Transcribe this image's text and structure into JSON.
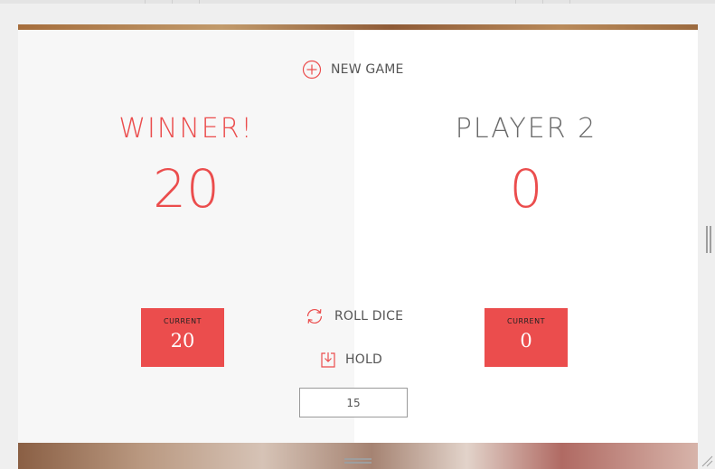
{
  "game": {
    "new_game_label": "NEW GAME",
    "roll_dice_label": "ROLL DICE",
    "hold_label": "HOLD",
    "final_score_value": "15"
  },
  "players": [
    {
      "name": "WINNER!",
      "score": "20",
      "current_label": "CURRENT",
      "current_score": "20",
      "status": "winner"
    },
    {
      "name": "PLAYER 2",
      "score": "0",
      "current_label": "CURRENT",
      "current_score": "0",
      "status": "inactive"
    }
  ],
  "colors": {
    "accent": "#eb4d4d",
    "panel_active": "#f7f7f7",
    "panel_inactive": "#ffffff",
    "text_muted": "#555555"
  },
  "icons": {
    "new_game": "plus-circle-icon",
    "roll_dice": "refresh-icon",
    "hold": "download-box-icon"
  }
}
